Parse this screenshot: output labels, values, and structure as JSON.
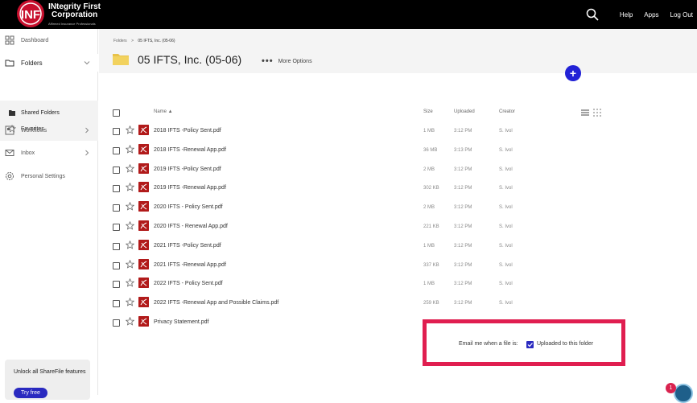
{
  "brand": {
    "name_line1": "INtegrity First",
    "name_line2": "Corporation",
    "tagline": "Affirmed Insurance Professionals",
    "logo_letters": "INF"
  },
  "topbar": {
    "help": "Help",
    "apps": "Apps",
    "logout": "Log Out"
  },
  "sidebar": {
    "dashboard": "Dashboard",
    "folders": "Folders",
    "shared_folders": "Shared Folders",
    "favorites": "Favorites",
    "workflows": "Workflows",
    "inbox": "Inbox",
    "personal_settings": "Personal Settings",
    "promo_text": "Unlock all ShareFile features",
    "promo_button": "Try free"
  },
  "breadcrumb": {
    "root": "Folders",
    "separator": ">",
    "current": "05 IFTS, Inc. (05-06)"
  },
  "page_title": "05 IFTS, Inc. (05-06)",
  "more_options": "More Options",
  "add_button": "+",
  "columns": {
    "name": "Name ▲",
    "size": "Size",
    "uploaded": "Uploaded",
    "creator": "Creator"
  },
  "files": [
    {
      "name": "2018 IFTS -Policy Sent.pdf",
      "size": "1 MB",
      "uploaded": "3:12 PM",
      "creator": "S. Ivol"
    },
    {
      "name": "2018 IFTS -Renewal App.pdf",
      "size": "36 MB",
      "uploaded": "3:13 PM",
      "creator": "S. Ivol"
    },
    {
      "name": "2019 IFTS -Policy Sent.pdf",
      "size": "2 MB",
      "uploaded": "3:12 PM",
      "creator": "S. Ivol"
    },
    {
      "name": "2019 IFTS -Renewal App.pdf",
      "size": "302 KB",
      "uploaded": "3:12 PM",
      "creator": "S. Ivol"
    },
    {
      "name": "2020 IFTS - Policy Sent.pdf",
      "size": "2 MB",
      "uploaded": "3:12 PM",
      "creator": "S. Ivol"
    },
    {
      "name": "2020 IFTS - Renewal App.pdf",
      "size": "221 KB",
      "uploaded": "3:12 PM",
      "creator": "S. Ivol"
    },
    {
      "name": "2021 IFTS -Policy Sent.pdf",
      "size": "1 MB",
      "uploaded": "3:12 PM",
      "creator": "S. Ivol"
    },
    {
      "name": "2021 IFTS -Renewal App.pdf",
      "size": "337 KB",
      "uploaded": "3:12 PM",
      "creator": "S. Ivol"
    },
    {
      "name": "2022 IFTS - Policy Sent.pdf",
      "size": "1 MB",
      "uploaded": "3:12 PM",
      "creator": "S. Ivol"
    },
    {
      "name": "2022 IFTS -Renewal App and Possible Claims.pdf",
      "size": "259 KB",
      "uploaded": "3:12 PM",
      "creator": "S. Ivol"
    },
    {
      "name": "Privacy Statement.pdf",
      "size": "",
      "uploaded": "",
      "creator": ""
    }
  ],
  "notify": {
    "label": "Email me when a file is:",
    "option": "Uploaded to this folder",
    "checked": true
  },
  "notification_badge": "1",
  "colors": {
    "topbar": "#000000",
    "accent": "#2222d6",
    "pdf": "#b11a1a",
    "highlight": "#e01e50"
  }
}
